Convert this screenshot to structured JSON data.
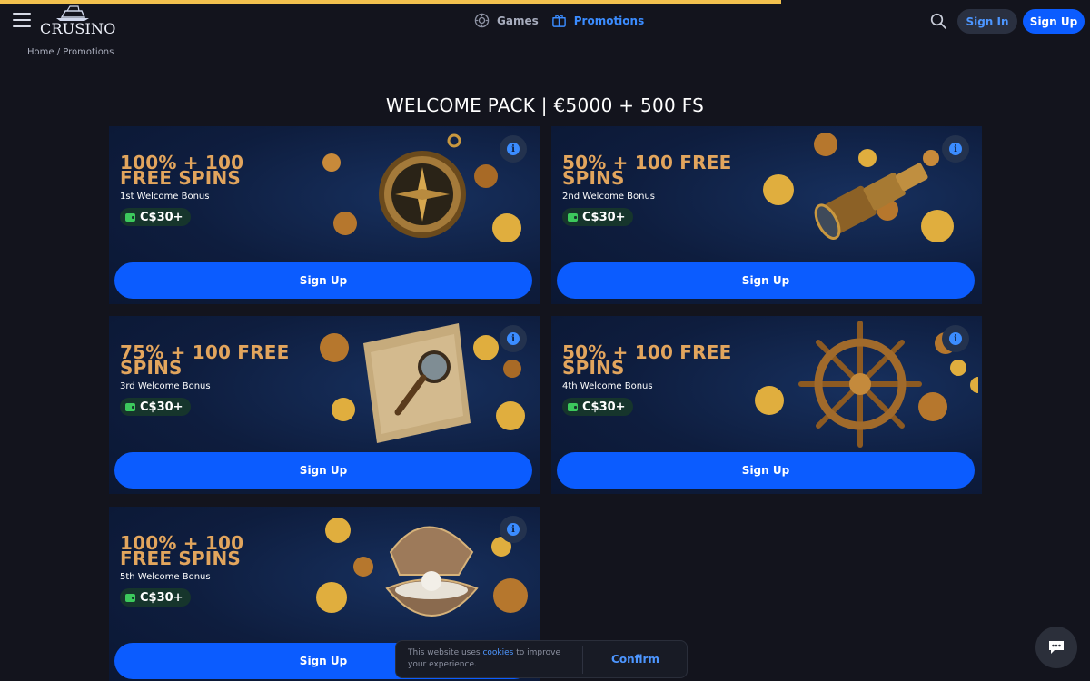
{
  "header": {
    "logo_text": "CRUSINO",
    "nav": [
      {
        "label": "Games",
        "icon": "games-icon"
      },
      {
        "label": "Promotions",
        "icon": "gift-icon"
      }
    ],
    "signin_label": "Sign In",
    "signup_label": "Sign Up"
  },
  "breadcrumb": {
    "home": "Home",
    "separator": " / ",
    "current": "Promotions"
  },
  "page_title": "WELCOME PACK | €5000 + 500 FS",
  "cards": [
    {
      "title": "100% + 100 FREE SPINS",
      "subtitle": "1st Welcome Bonus",
      "badge": "C$30+",
      "button": "Sign Up",
      "art": "compass-icon"
    },
    {
      "title": "50% + 100 FREE SPINS",
      "subtitle": "2nd Welcome Bonus",
      "badge": "C$30+",
      "button": "Sign Up",
      "art": "telescope-icon"
    },
    {
      "title": "75% + 100 FREE SPINS",
      "subtitle": "3rd Welcome Bonus",
      "badge": "C$30+",
      "button": "Sign Up",
      "art": "map-magnifier-icon"
    },
    {
      "title": "50% + 100 FREE SPINS",
      "subtitle": "4th Welcome Bonus",
      "badge": "C$30+",
      "button": "Sign Up",
      "art": "ship-wheel-icon"
    },
    {
      "title": "100% + 100 FREE SPINS",
      "subtitle": "5th Welcome Bonus",
      "badge": "C$30+",
      "button": "Sign Up",
      "art": "pearl-shell-icon"
    }
  ],
  "cookie": {
    "text_before": "This website uses ",
    "link": "cookies",
    "text_after": " to improve your experience.",
    "confirm": "Confirm"
  },
  "colors": {
    "accent": "#0b5cff",
    "gold": "#e2a55d",
    "background": "#13141d",
    "card": "#0d1b3a"
  }
}
